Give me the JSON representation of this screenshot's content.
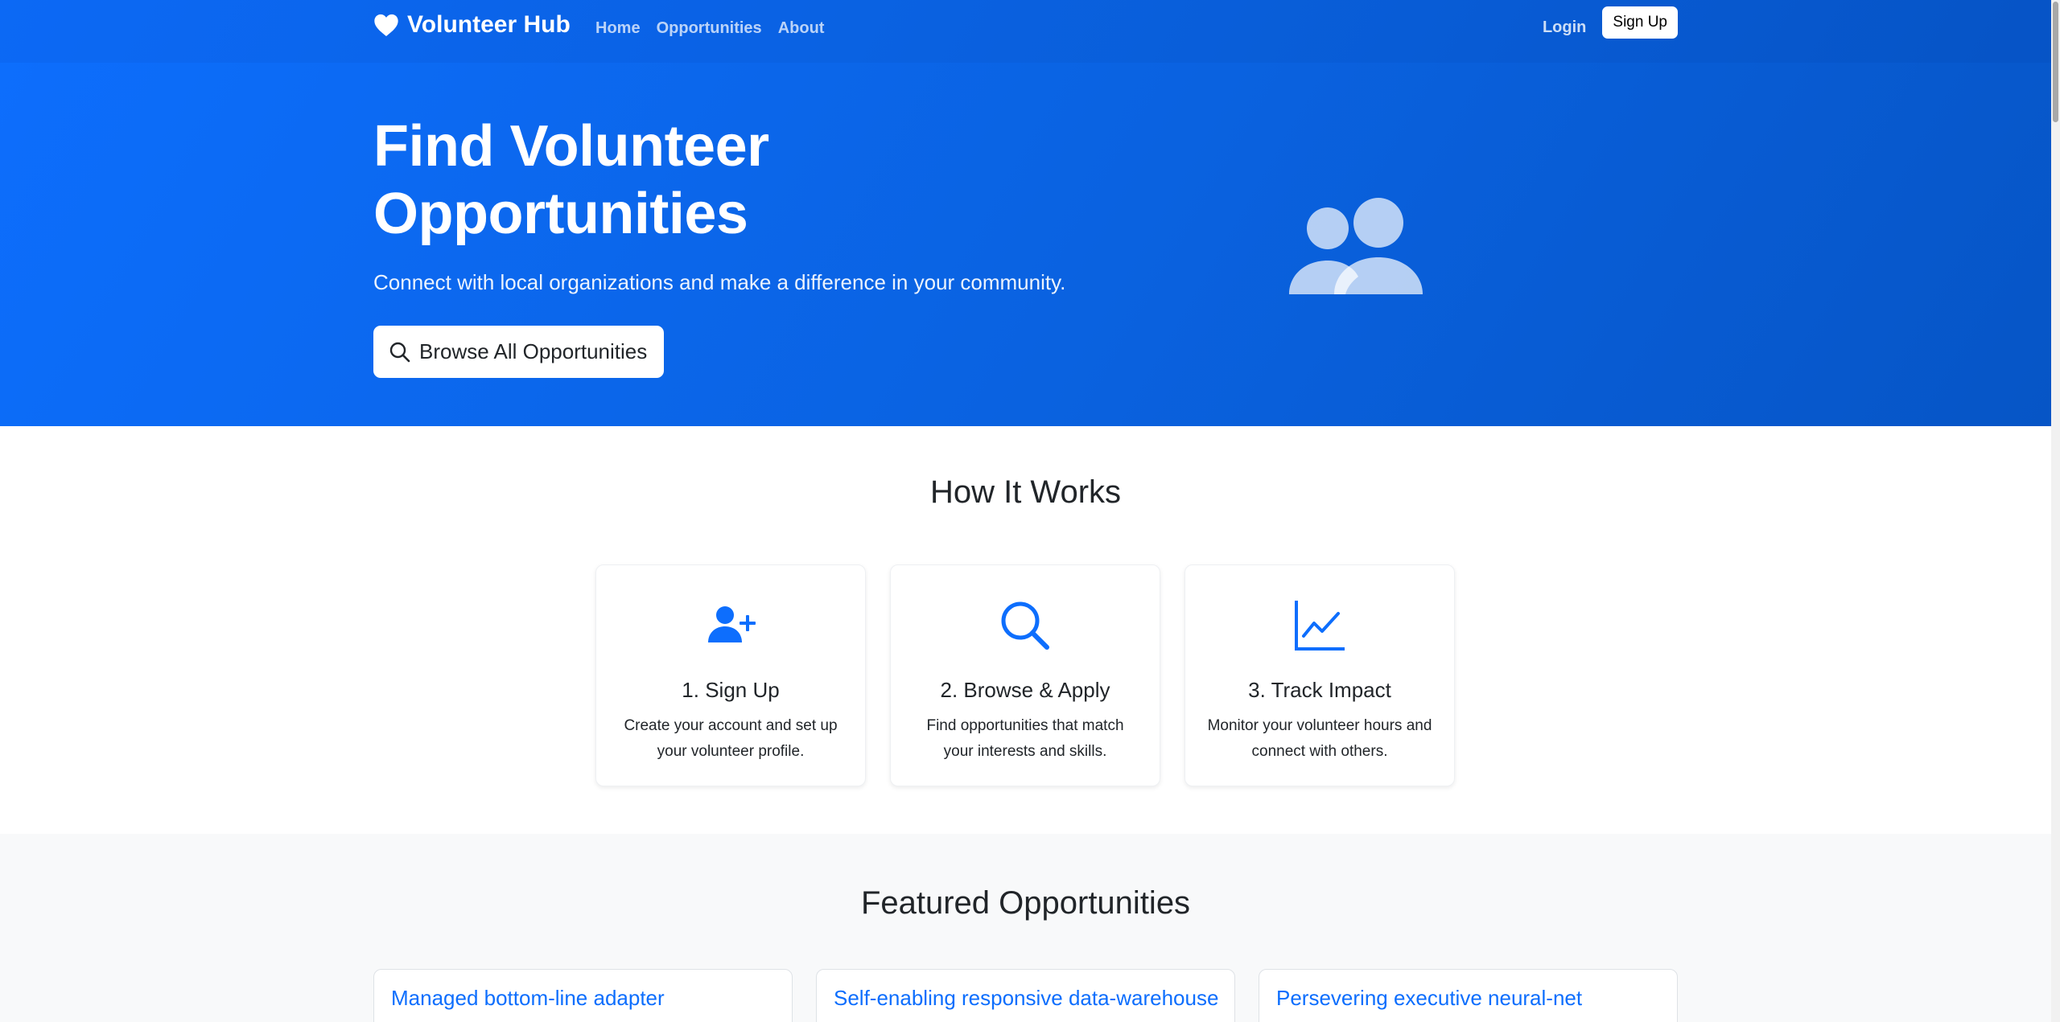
{
  "navbar": {
    "brand": "Volunteer Hub",
    "brand_icon": "heart-icon",
    "links": [
      "Home",
      "Opportunities",
      "About"
    ],
    "login": "Login",
    "signup": "Sign Up"
  },
  "hero": {
    "title": "Find Volunteer Opportunities",
    "subtitle": "Connect with local organizations and make a difference in your community.",
    "button_label": "Browse All Opportunities",
    "button_icon": "search-icon",
    "illustration_icon": "people-icon"
  },
  "how_it_works": {
    "title": "How It Works",
    "steps": [
      {
        "icon": "person-plus-icon",
        "title": "1. Sign Up",
        "description": "Create your account and set up your volunteer profile."
      },
      {
        "icon": "search-icon",
        "title": "2. Browse & Apply",
        "description": "Find opportunities that match your interests and skills."
      },
      {
        "icon": "graph-up-icon",
        "title": "3. Track Impact",
        "description": "Monitor your volunteer hours and connect with others."
      }
    ]
  },
  "featured": {
    "title": "Featured Opportunities",
    "opportunities": [
      {
        "title": "Managed bottom-line adapter"
      },
      {
        "title": "Self-enabling responsive data-warehouse"
      },
      {
        "title": "Persevering executive neural-net"
      }
    ]
  },
  "colors": {
    "primary": "#0d6efd",
    "hero_gradient_end": "#0655c6",
    "section_alt_bg": "#f8f9fa",
    "text": "#212529"
  }
}
